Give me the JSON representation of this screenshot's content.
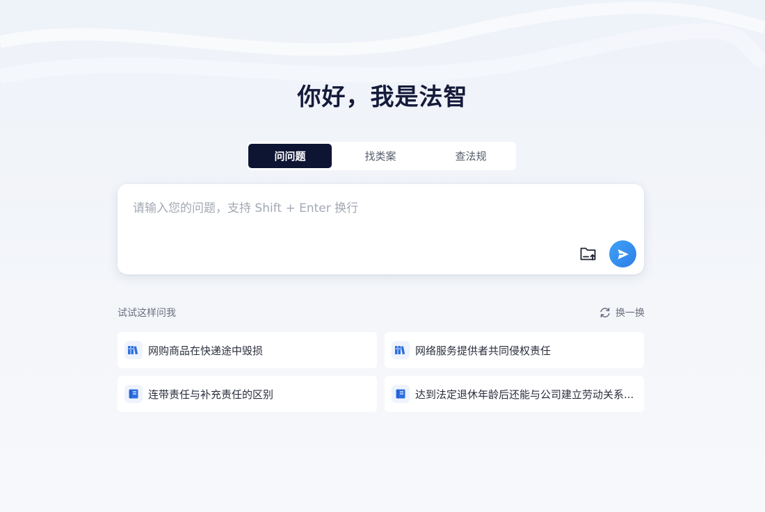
{
  "header": {
    "title": "你好，我是法智"
  },
  "tabs": [
    {
      "label": "问问题",
      "active": true
    },
    {
      "label": "找类案",
      "active": false
    },
    {
      "label": "查法规",
      "active": false
    }
  ],
  "input": {
    "placeholder": "请输入您的问题，支持 Shift + Enter 换行",
    "value": "",
    "upload_icon": "folder-upload-icon",
    "send_icon": "send-icon"
  },
  "suggestions": {
    "heading": "试试这样问我",
    "refresh_label": "换一换",
    "refresh_icon": "refresh-icon",
    "items": [
      {
        "label": "网购商品在快递途中毁损",
        "icon": "books-icon"
      },
      {
        "label": "网络服务提供者共同侵权责任",
        "icon": "books-icon"
      },
      {
        "label": "连带责任与补充责任的区别",
        "icon": "book-icon"
      },
      {
        "label": "达到法定退休年龄后还能与公司建立劳动关系...",
        "icon": "book-icon"
      }
    ]
  },
  "colors": {
    "accent": "#2f7ee8",
    "tab_active_bg": "#0e1533",
    "title": "#151b3a",
    "icon_blue": "#2d6fe0"
  }
}
